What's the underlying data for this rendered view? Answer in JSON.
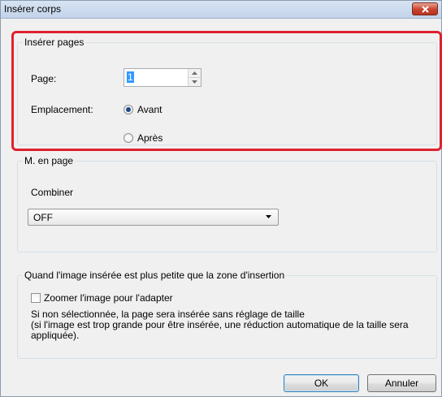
{
  "window": {
    "title": "Insérer corps"
  },
  "insert_pages": {
    "legend": "Insérer pages",
    "page_label": "Page:",
    "page_value": "1",
    "location_label": "Emplacement:",
    "option_before": "Avant",
    "option_after": "Après",
    "selected": "Avant"
  },
  "layout": {
    "legend": "M. en page",
    "combine_label": "Combiner",
    "combine_value": "OFF"
  },
  "smaller_image": {
    "legend": "Quand l'image insérée est plus petite que la zone d'insertion",
    "zoom_label": "Zoomer l'image pour l'adapter",
    "zoom_checked": false,
    "note_line1": "Si non sélectionnée, la page sera insérée sans réglage de taille",
    "note_line2": "(si l'image est trop grande pour être insérée, une réduction automatique de la taille sera",
    "note_line3": "appliquée)."
  },
  "buttons": {
    "ok": "OK",
    "cancel": "Annuler"
  },
  "colors": {
    "highlight": "#e0212e",
    "close_button": "#c7432d",
    "default_button_border": "#3c7fb1"
  }
}
